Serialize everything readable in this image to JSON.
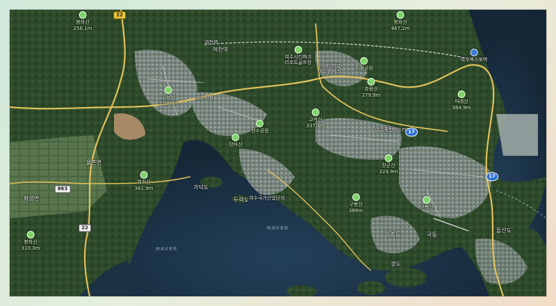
{
  "watermark": "NAVER",
  "colors": {
    "forest": "#2c4a2a",
    "sea": "#1d3447",
    "urban": "#8e9a94",
    "road_major": "#e3c25a",
    "road_minor": "#d9d9d9",
    "poi_green": "#7fd36a"
  },
  "mountains": [
    {
      "name": "봉화산",
      "elev": "256.1m"
    },
    {
      "name": "봉화산",
      "elev": "467.2m"
    },
    {
      "name": "무선산",
      "elev": "215.9m"
    },
    {
      "name": "호랑산",
      "elev": "279.9m"
    },
    {
      "name": "고락산",
      "elev": "337.4m"
    },
    {
      "name": "영취산",
      "elev": "341.9m"
    },
    {
      "name": "구봉산",
      "elev": "386m"
    },
    {
      "name": "장군산",
      "elev": "324.9m"
    },
    {
      "name": "마래산",
      "elev": "384.9m"
    },
    {
      "name": "망마산",
      "elev": ""
    },
    {
      "name": "구봉산",
      "elev": ""
    },
    {
      "name": "봉화산",
      "elev": "310.3m"
    }
  ],
  "pois": [
    {
      "name": "여수시티파크\n리조트골프장"
    },
    {
      "name": "여수엑스포역"
    },
    {
      "name": "여천역"
    },
    {
      "name": "전남대학교\n여수캠퍼스"
    },
    {
      "name": "미평공원"
    },
    {
      "name": "여수시청"
    },
    {
      "name": "여수종합버스터미널"
    },
    {
      "name": "여수국가산업단지"
    },
    {
      "name": "선소공원"
    }
  ],
  "places": [
    {
      "name": "여천역"
    },
    {
      "name": "가덕도"
    },
    {
      "name": "두력도"
    },
    {
      "name": "경도"
    },
    {
      "name": "돌산도"
    },
    {
      "name": "화양면"
    },
    {
      "name": "율촌면"
    },
    {
      "name": "덕충동"
    },
    {
      "name": "국동"
    }
  ],
  "shields": [
    {
      "label": "22",
      "kind": "yellow"
    },
    {
      "label": "22",
      "kind": "white"
    },
    {
      "label": "863",
      "kind": "white"
    },
    {
      "label": "17",
      "kind": "blue"
    },
    {
      "label": "17",
      "kind": "blue"
    }
  ]
}
